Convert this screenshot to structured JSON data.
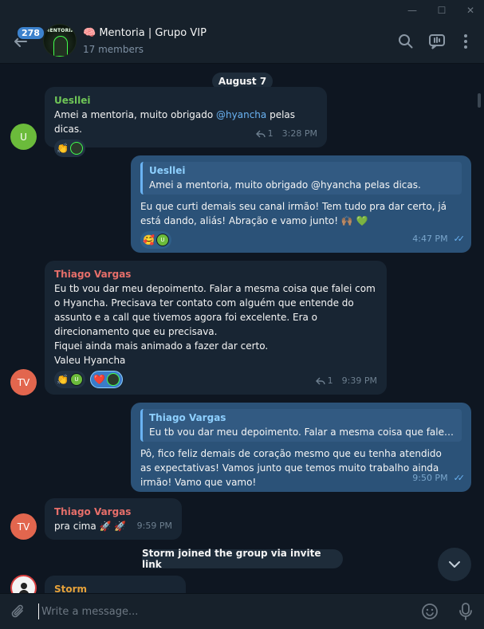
{
  "window": {
    "minimize": "—",
    "maximize": "☐",
    "close": "✕"
  },
  "header": {
    "unread_count": "278",
    "avatar_text": "MENTORIA",
    "title": "🧠 Mentoria | Grupo VIP",
    "subtitle": "17 members",
    "icons": [
      "back-arrow-icon",
      "search-icon",
      "live-chat-icon",
      "more-vertical-icon"
    ]
  },
  "chat": {
    "date": "August 7",
    "messages": [
      {
        "sender": "Uesllei",
        "avatar": "U",
        "text_before": "Amei a mentoria, muito obrigado ",
        "mention": "@hyancha",
        "text_after": " pelas dicas.",
        "reactions": [
          {
            "emoji": "👏",
            "users": [
              "avatar-photo"
            ]
          }
        ],
        "reply_count": "1",
        "time": "3:28 PM"
      },
      {
        "outgoing": true,
        "quote_name": "Uesllei",
        "quote_text": "Amei a mentoria, muito obrigado @hyancha pelas dicas.",
        "text": "Eu que curti demais seu canal irmão! Tem tudo pra dar certo, já está dando, aliás! Abração e vamo junto! 🙌🏽 💚",
        "reactions": [
          {
            "emoji": "🥰",
            "users": [
              "U"
            ]
          }
        ],
        "time": "4:47 PM",
        "read": true
      },
      {
        "sender": "Thiago Vargas",
        "avatar": "TV",
        "text": "Eu tb vou dar meu depoimento. Falar a mesma coisa que falei com o Hyancha. Precisava ter contato com alguém que entende do assunto e a call que tivemos agora foi excelente. Era o direcionamento que eu precisava.\nFiquei ainda mais animado a fazer dar certo.\nValeu Hyancha",
        "reactions": [
          {
            "emoji": "👏",
            "users": [
              "U"
            ]
          },
          {
            "emoji": "❤️",
            "users": [
              "avatar-photo"
            ],
            "selected": true
          }
        ],
        "reply_count": "1",
        "time": "9:39 PM"
      },
      {
        "outgoing": true,
        "quote_name": "Thiago Vargas",
        "quote_text": "Eu tb vou dar meu depoimento. Falar a mesma coisa que falei co...",
        "text": "Pô, fico feliz demais de coração mesmo que eu tenha atendido as expectativas! Vamos junto que temos muito trabalho ainda irmão! Vamo que vamo!",
        "time": "9:50 PM",
        "read": true
      },
      {
        "sender": "Thiago Vargas",
        "avatar": "TV",
        "text": "pra cima 🚀 🚀",
        "time": "9:59 PM"
      },
      {
        "sender": "Storm",
        "avatar": "photo"
      }
    ],
    "service_message": "Storm joined the group via invite link"
  },
  "composer": {
    "placeholder": "Write a message...",
    "icons": [
      "attach-icon",
      "emoji-icon",
      "microphone-icon"
    ]
  },
  "colors": {
    "background": "#0e1621",
    "incoming_bubble": "#182533",
    "outgoing_bubble": "#2b5278",
    "accent": "#6ab3f3"
  }
}
